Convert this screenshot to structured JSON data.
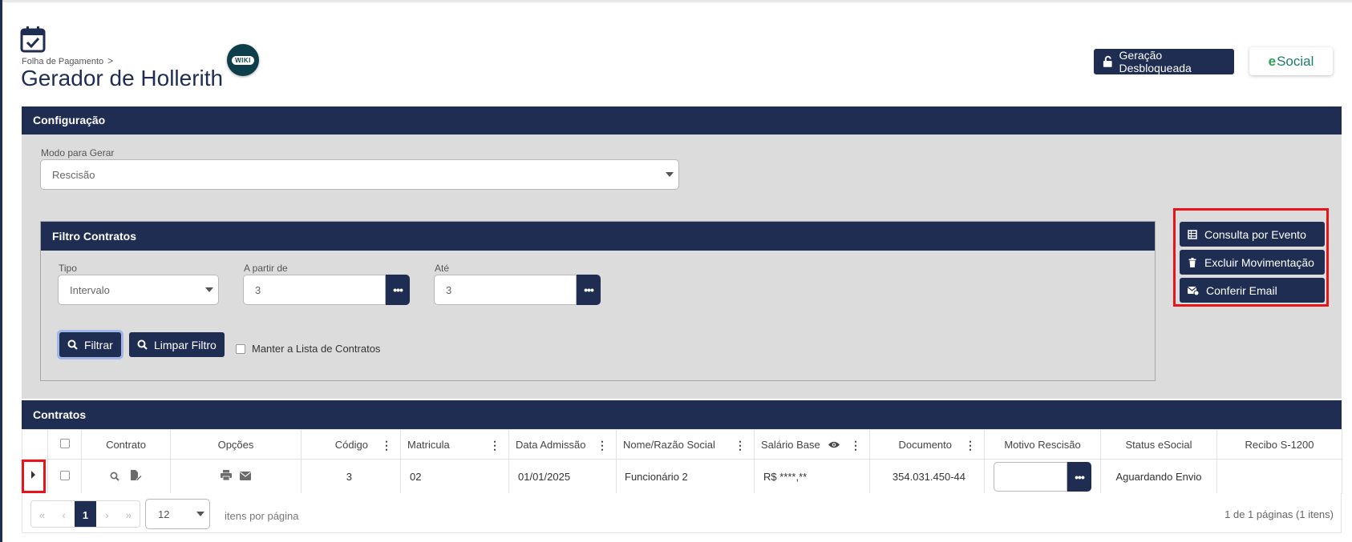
{
  "header": {
    "breadcrumb": "Folha de Pagamento",
    "breadcrumb_sep": ">",
    "title": "Gerador de Hollerith",
    "wiki_label": "WIKI",
    "unlock_button": "Geração Desbloqueada",
    "esocial_brand_e": "e",
    "esocial_label": "Social"
  },
  "config": {
    "title": "Configuração",
    "modo_label": "Modo para Gerar",
    "modo_value": "Rescisão"
  },
  "filtro": {
    "title": "Filtro Contratos",
    "tipo_label": "Tipo",
    "tipo_value": "Intervalo",
    "apartir_label": "A partir de",
    "apartir_value": "3",
    "ate_label": "Até",
    "ate_value": "3",
    "filtrar_button": "Filtrar",
    "limpar_button": "Limpar Filtro",
    "manter_label": "Manter a Lista de Contratos"
  },
  "actions": {
    "consulta": "Consulta por Evento",
    "excluir": "Excluir Movimentação",
    "conferir": "Conferir Email"
  },
  "contratos": {
    "title": "Contratos",
    "columns": {
      "contrato": "Contrato",
      "opcoes": "Opções",
      "codigo": "Código",
      "matricula": "Matricula",
      "admissao": "Data Admissão",
      "nome": "Nome/Razão Social",
      "salario": "Salário Base",
      "documento": "Documento",
      "motivo": "Motivo Rescisão",
      "status": "Status eSocial",
      "recibo": "Recibo S-1200"
    },
    "rows": [
      {
        "codigo": "3",
        "matricula": "02",
        "admissao": "01/01/2025",
        "nome": "Funcionário 2",
        "salario": "R$ ****,**",
        "documento": "354.031.450-44",
        "motivo": "",
        "status": "Aguardando Envio",
        "recibo": ""
      }
    ]
  },
  "pager": {
    "first": "«",
    "prev": "‹",
    "current_page": "1",
    "next": "›",
    "last": "»",
    "page_size": "12",
    "per_page_label": "itens por página",
    "summary": "1 de 1 páginas (1 itens)"
  },
  "colors": {
    "navy": "#1f2d52",
    "panel_bg": "#dcdcdc",
    "highlight_red": "#e8141a",
    "esocial_green": "#2ba24c"
  }
}
